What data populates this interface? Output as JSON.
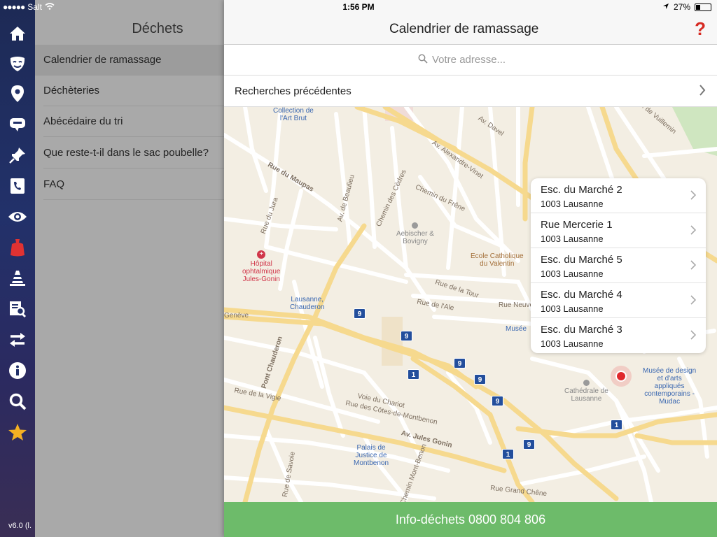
{
  "status_bar": {
    "carrier": "Salt",
    "time": "1:56 PM",
    "battery": "27%"
  },
  "rail": {
    "icons": [
      "home-icon",
      "mask-icon",
      "location-pin-icon",
      "speech-bubble-icon",
      "push-pin-icon",
      "phone-book-icon",
      "eye-icon",
      "waste-bag-icon",
      "traffic-cone-icon",
      "document-search-icon",
      "exchange-arrows-icon",
      "info-icon",
      "search-icon",
      "star-icon"
    ],
    "version": "v6.0 (l."
  },
  "menu": {
    "title": "Déchets",
    "items": [
      "Calendrier de ramassage",
      "Déchèteries",
      "Abécédaire du tri",
      "Que reste-t-il dans le sac poubelle?",
      "FAQ"
    ]
  },
  "header": {
    "title": "Calendrier de ramassage",
    "help": "?"
  },
  "search": {
    "placeholder": "Votre adresse..."
  },
  "recent": {
    "label": "Recherches précédentes"
  },
  "results": [
    {
      "street": "Esc. du Marché 2",
      "city": "1003 Lausanne"
    },
    {
      "street": "Rue Mercerie 1",
      "city": "1003 Lausanne"
    },
    {
      "street": "Esc. du Marché 5",
      "city": "1003 Lausanne"
    },
    {
      "street": "Esc. du Marché 4",
      "city": "1003 Lausanne"
    },
    {
      "street": "Esc. du Marché 3",
      "city": "1003 Lausanne"
    }
  ],
  "map": {
    "streets": [
      "Rue du Maupas",
      "Av. de Beaulieu",
      "Chemin des Cèdres",
      "Chemin du Frêne",
      "Av. Alexandre-Vinet",
      "Av. Davel",
      "Ch. de Vuillemin",
      "Rue du Jura",
      "Rue de la Tour",
      "Rue de l'Ale",
      "Rue Neuve",
      "Genève",
      "Pont Chauderon",
      "Rue de la Vigie",
      "Voie du Chariot",
      "Rue des Côtes-de-Montbenon",
      "Av. Jules Gonin",
      "Rue Grand Chêne",
      "Rue de Savoie",
      "Chemin Mont-Benon"
    ],
    "places": {
      "art_brut": [
        "Collection de",
        "l'Art Brut"
      ],
      "hopital": [
        "Hôpital",
        "ophtalmique",
        "Jules-Gonin"
      ],
      "chauderon": [
        "Lausanne,",
        "Chauderon"
      ],
      "aebischer": [
        "Aebischer &",
        "Bovigny"
      ],
      "ecole": [
        "Ecole Catholique",
        "du Valentin"
      ],
      "musee_short": "Musée",
      "mudac": [
        "Musée de design",
        "et d'arts",
        "appliqués",
        "contemporains -",
        "Mudac"
      ],
      "cathedrale": [
        "Cathédrale de",
        "Lausanne"
      ],
      "palais": [
        "Palais de",
        "Justice de",
        "Montbenon"
      ]
    },
    "bus_stops": [
      "9",
      "9",
      "9",
      "9",
      "1",
      "9",
      "9",
      "1",
      "1",
      "9"
    ]
  },
  "footer": {
    "label": "Info-déchets 0800 804 806"
  }
}
